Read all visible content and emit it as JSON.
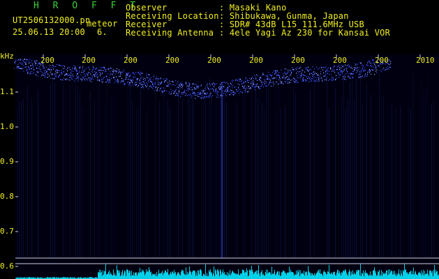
{
  "header": {
    "app_title": "H R O F F T",
    "filename": "UT2506132000.pn",
    "meteor_label": "meteor",
    "datetime": "25.06.13 20:00",
    "count": "6.",
    "fields": [
      {
        "label": "Observer",
        "value": ": Masaki Kano"
      },
      {
        "label": "Receiving Location",
        "value": ": Shibukawa, Gunma, Japan"
      },
      {
        "label": "Receiver",
        "value": ": SDR# 43dB L15 111.6MHz USB"
      },
      {
        "label": "Receiving Antenna",
        "value": ": 4ele Yagi Az 230 for Kansai VOR"
      }
    ]
  },
  "y_axis": {
    "unit": "kHz",
    "ticks": [
      "1.1",
      "1.0",
      "0.9",
      "0.8",
      "0.7",
      "0.6"
    ]
  },
  "x_axis": {
    "ticks": [
      "200",
      "200",
      "200",
      "200",
      "200",
      "200",
      "200",
      "200",
      "200",
      "2010"
    ]
  },
  "colors": {
    "text": "#f2f020",
    "title": "#3ad23a",
    "echo": "#3a4dff",
    "background": "#000000",
    "spectrum": "#00d0e8"
  }
}
